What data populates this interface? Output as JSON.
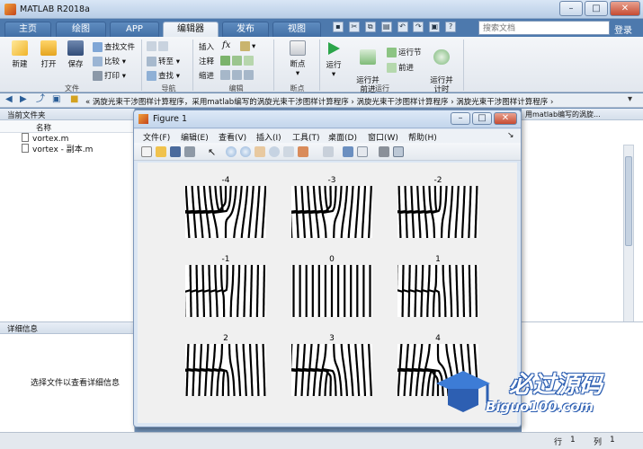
{
  "window": {
    "title": "MATLAB R2018a"
  },
  "tabs": [
    {
      "label": "主页",
      "active": false
    },
    {
      "label": "绘图",
      "active": false
    },
    {
      "label": "APP",
      "active": false
    },
    {
      "label": "编辑器",
      "active": true
    },
    {
      "label": "发布",
      "active": false
    },
    {
      "label": "视图",
      "active": false
    }
  ],
  "search": {
    "placeholder": "搜索文档"
  },
  "signin": "登录",
  "ribbon": {
    "file": {
      "new": "新建",
      "open": "打开",
      "save": "保存",
      "find_files": "查找文件",
      "compare": "比较",
      "print": "打印",
      "group": "文件"
    },
    "nav": {
      "goto": "转至",
      "find": "查找",
      "group": "导航"
    },
    "edit": {
      "insert": "插入",
      "comment": "注释",
      "indent": "缩进",
      "fx": "fx",
      "group": "编辑"
    },
    "breakpoints": {
      "label": "断点",
      "group": "断点"
    },
    "run": {
      "run": "运行",
      "run_advance": "运行并\n前进",
      "run_section": "运行节",
      "advance": "前进",
      "run_time": "运行并\n计时",
      "group": "运行"
    }
  },
  "address": {
    "path": "« 涡旋光束干涉图样计算程序，采用matlab编写的涡旋光束干涉图样计算程序 › 涡旋光束干涉图样计算程序 › 涡旋光束干涉图样计算程序 ›"
  },
  "left_panel": {
    "title": "当前文件夹",
    "column": "名称",
    "files": [
      "vortex.m",
      "vortex - 副本.m"
    ]
  },
  "detail_panel": {
    "title": "详细信息",
    "message": "选择文件以查看详细信息"
  },
  "right_pane": {
    "title": "用matlab编写的涡旋..."
  },
  "status": {
    "row_label": "行",
    "row": "1",
    "col_label": "列",
    "col": "1"
  },
  "figure": {
    "title": "Figure 1",
    "menu": [
      "文件(F)",
      "编辑(E)",
      "查看(V)",
      "插入(I)",
      "工具(T)",
      "桌面(D)",
      "窗口(W)",
      "帮助(H)"
    ],
    "plots": [
      {
        "label": "-4",
        "l": -4
      },
      {
        "label": "-3",
        "l": -3
      },
      {
        "label": "-2",
        "l": -2
      },
      {
        "label": "-1",
        "l": -1
      },
      {
        "label": "0",
        "l": 0
      },
      {
        "label": "1",
        "l": 1
      },
      {
        "label": "2",
        "l": 2
      },
      {
        "label": "3",
        "l": 3
      },
      {
        "label": "4",
        "l": 4
      }
    ]
  },
  "watermark": {
    "text": "必过源码",
    "url": "Biguo100.com"
  }
}
